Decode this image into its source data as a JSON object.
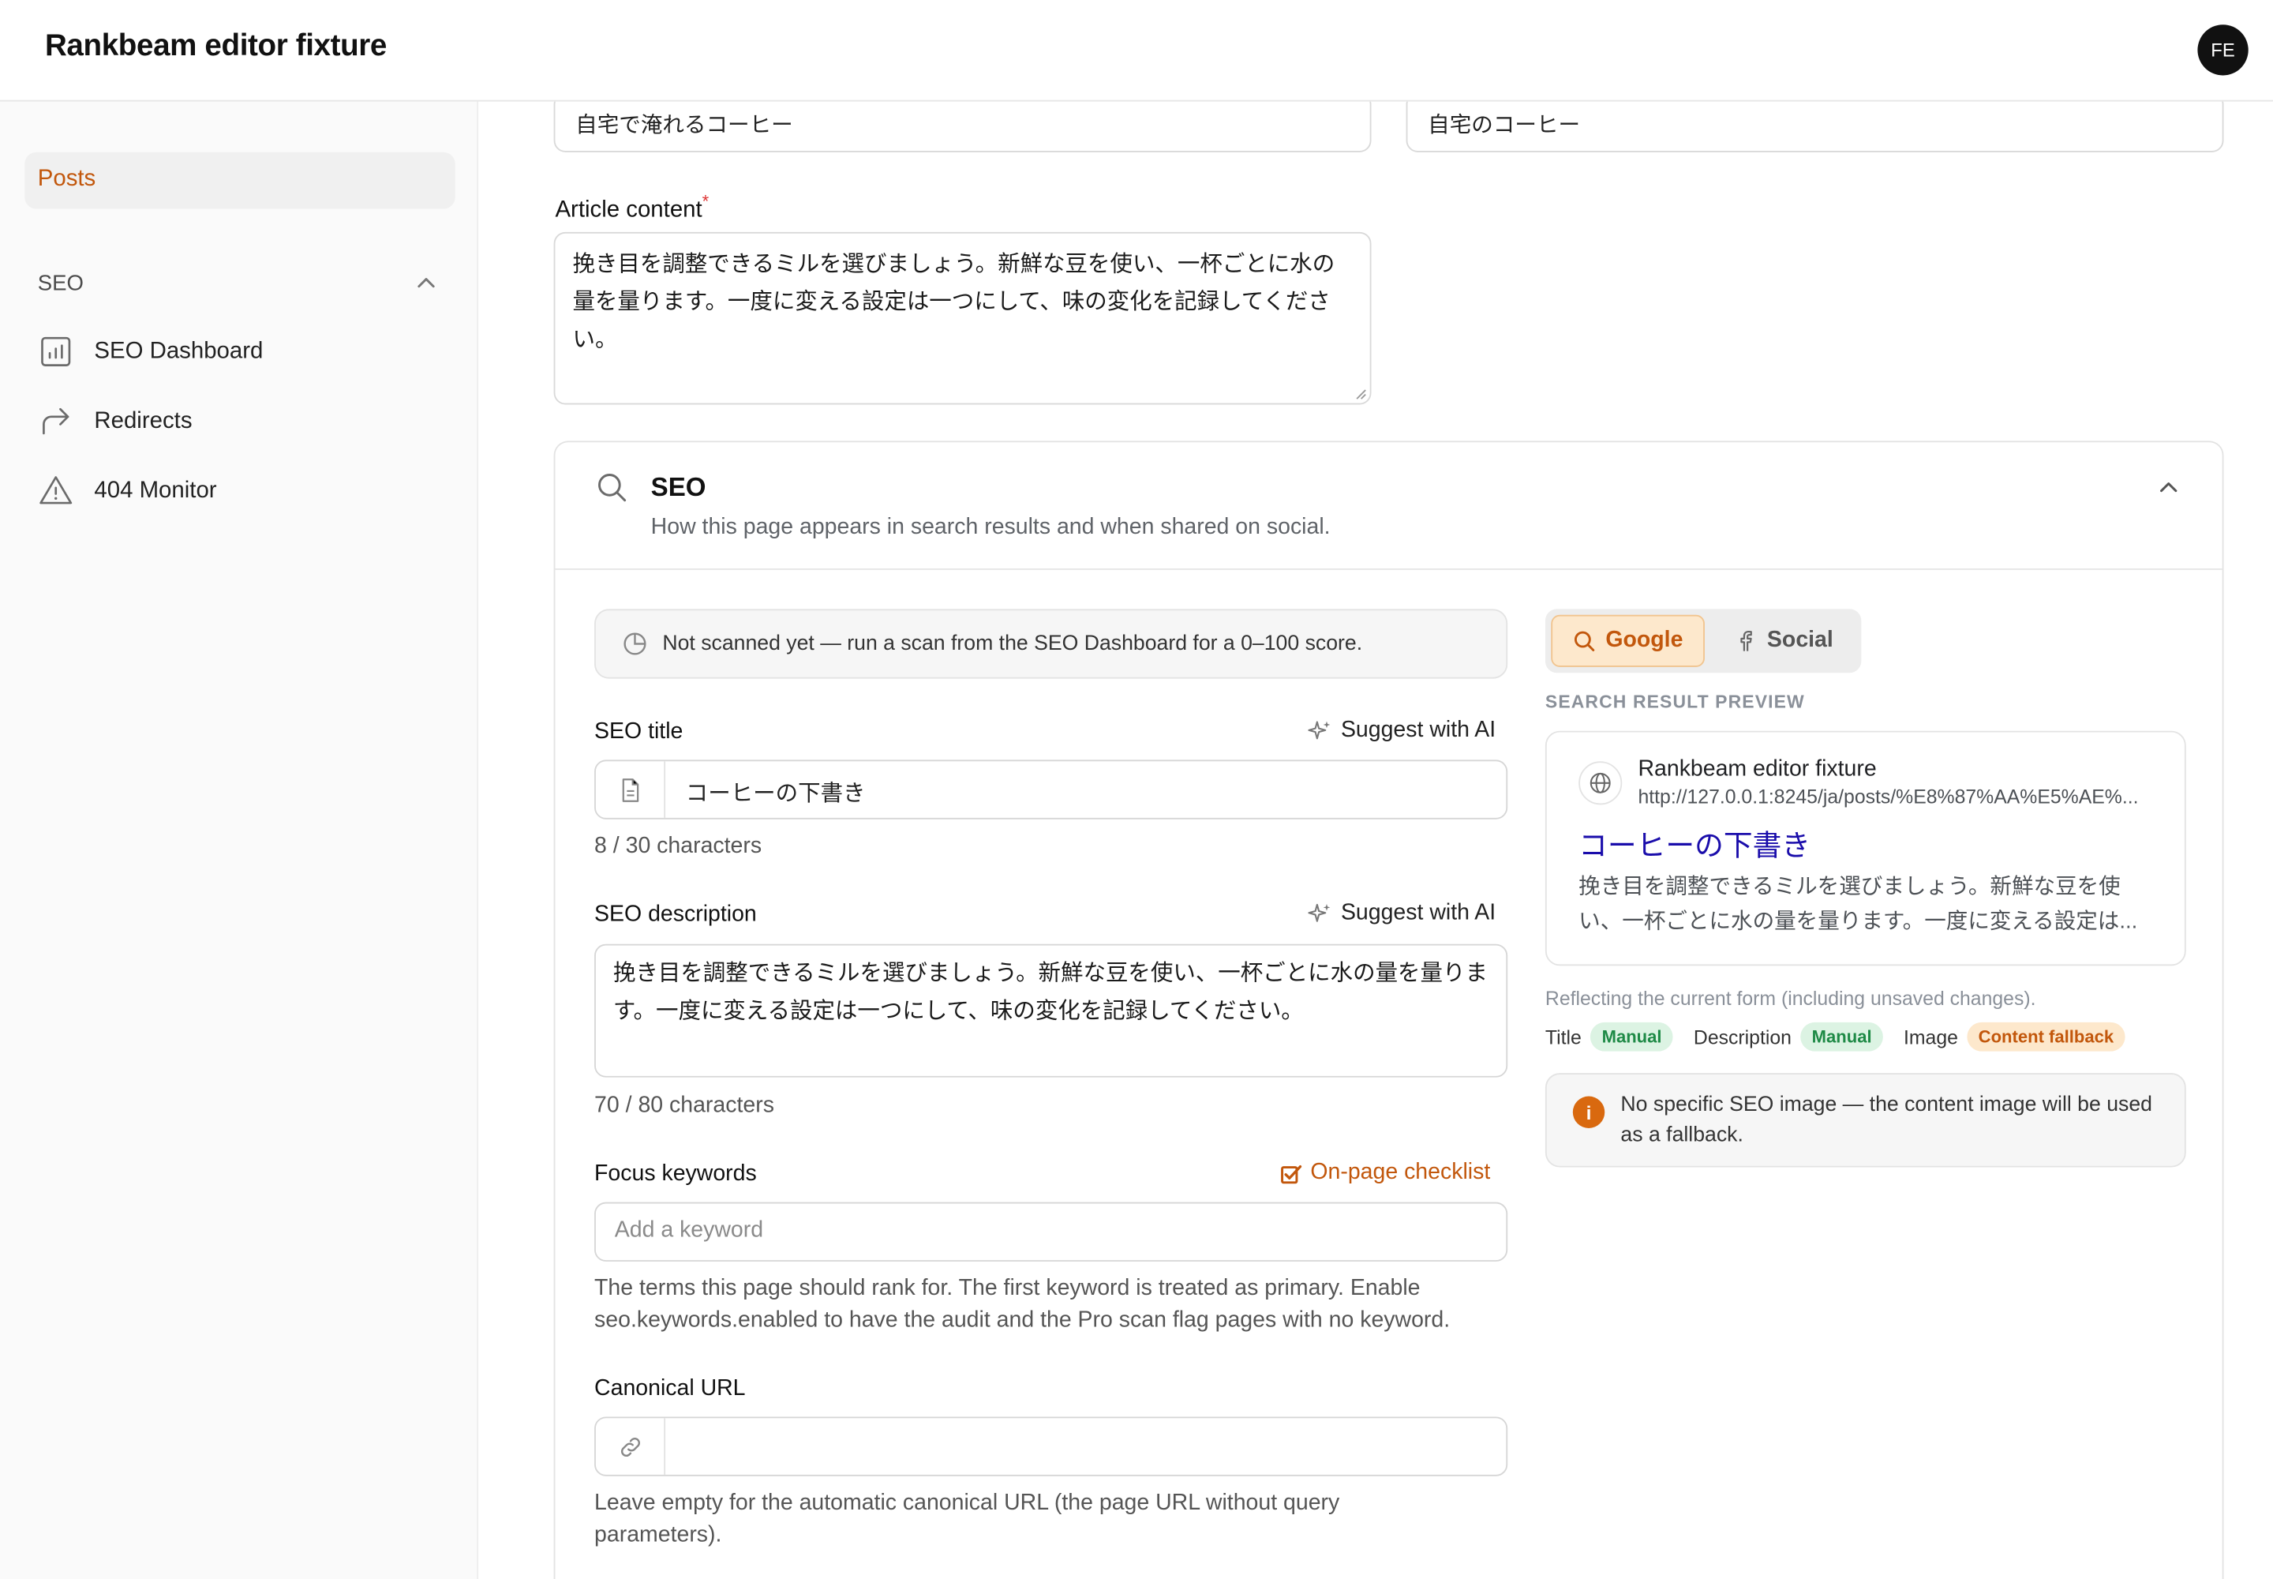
{
  "app": {
    "title": "Rankbeam editor fixture",
    "avatar_initials": "FE"
  },
  "sidebar": {
    "posts_label": "Posts",
    "group_label": "SEO",
    "items": [
      {
        "label": "SEO Dashboard",
        "icon": "bar-chart-icon"
      },
      {
        "label": "Redirects",
        "icon": "redirect-arrow-icon"
      },
      {
        "label": "404 Monitor",
        "icon": "warning-icon"
      }
    ]
  },
  "form": {
    "title_value": "自宅で淹れるコーヒー",
    "slug_value": "自宅のコーヒー",
    "article_label": "Article content",
    "article_required_mark": "*",
    "article_content": "挽き目を調整できるミルを選びましょう。新鮮な豆を使い、一杯ごとに水の量を量ります。一度に変える設定は一つにして、味の変化を記録してください。"
  },
  "seo": {
    "title": "SEO",
    "subtitle": "How this page appears in search results and when shared on social.",
    "scan_note": "Not scanned yet — run a scan from the SEO Dashboard for a 0–100 score.",
    "seo_title_label": "SEO title",
    "suggest_ai_label": "Suggest with AI",
    "seo_title_value": "コーヒーの下書き",
    "seo_title_count": "8 / 30 characters",
    "seo_desc_label": "SEO description",
    "seo_desc_value": "挽き目を調整できるミルを選びましょう。新鮮な豆を使い、一杯ごとに水の量を量ります。一度に変える設定は一つにして、味の変化を記録してください。",
    "seo_desc_count": "70 / 80 characters",
    "focus_label": "Focus keywords",
    "checklist_label": "On-page checklist",
    "keyword_placeholder": "Add a keyword",
    "focus_help": "The terms this page should rank for. The first keyword is treated as primary. Enable seo.keywords.enabled to have the audit and the Pro scan flag pages with no keyword.",
    "canonical_label": "Canonical URL",
    "canonical_value": "",
    "canonical_help": "Leave empty for the automatic canonical URL (the page URL without query parameters)."
  },
  "preview": {
    "tab_google": "Google",
    "tab_social": "Social",
    "caption": "SEARCH RESULT PREVIEW",
    "site_name": "Rankbeam editor fixture",
    "url": "http://127.0.0.1:8245/ja/posts/%E8%87%AA%E5%AE%...",
    "title": "コーヒーの下書き",
    "description": "挽き目を調整できるミルを選びましょう。新鮮な豆を使い、一杯ごとに水の量を量ります。一度に変える設定は...",
    "reflect_note": "Reflecting the current form (including unsaved changes).",
    "sources": [
      {
        "key": "Title",
        "value": "Manual"
      },
      {
        "key": "Description",
        "value": "Manual"
      },
      {
        "key": "Image",
        "value": "Content fallback"
      }
    ],
    "image_note": "No specific SEO image — the content image will be used as a fallback."
  },
  "colors": {
    "accent": "#c2570c",
    "link_blue": "#1a0dab",
    "manual_green": "#1e8a46"
  }
}
